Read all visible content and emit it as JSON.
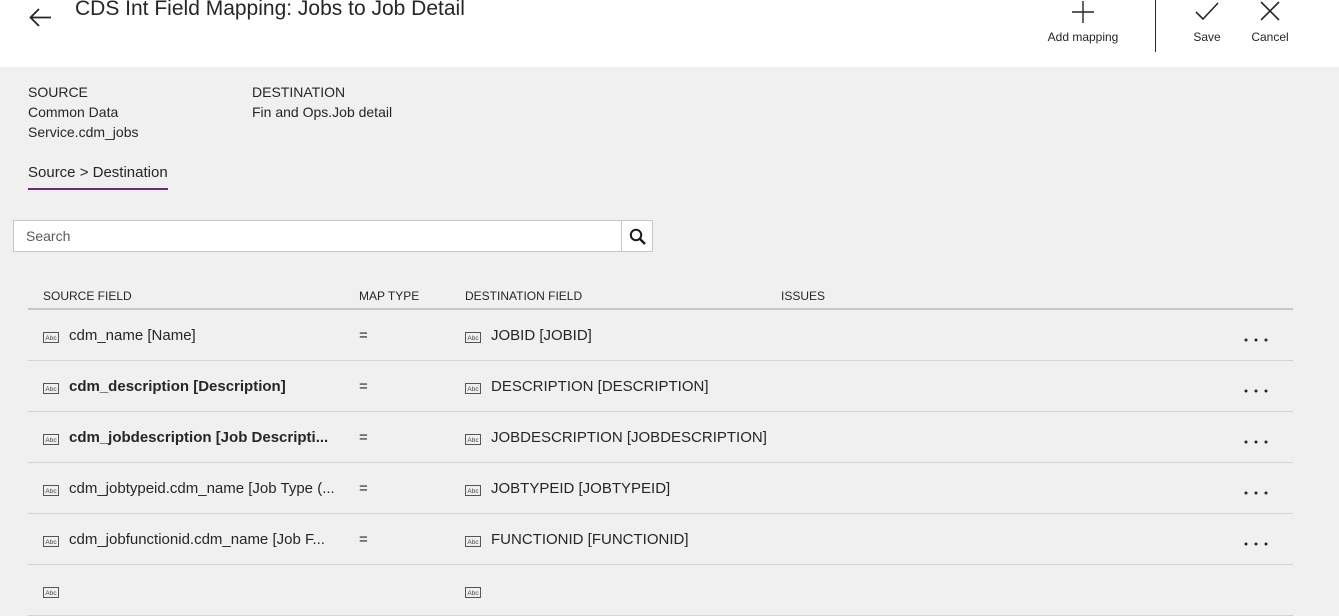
{
  "header": {
    "title": "CDS Int Field Mapping: Jobs to Job Detail",
    "back_icon": "arrow-left-icon",
    "commands": [
      {
        "label": "Add mapping",
        "icon": "plus-icon"
      },
      {
        "label": "Save",
        "icon": "checkmark-icon"
      },
      {
        "label": "Cancel",
        "icon": "close-icon"
      }
    ]
  },
  "source": {
    "heading": "SOURCE",
    "line1": "Common Data",
    "line2": "Service.cdm_jobs"
  },
  "destination": {
    "heading": "DESTINATION",
    "value": "Fin and Ops.Job detail"
  },
  "tab": {
    "label": "Source > Destination",
    "accent_color": "#6b2c72"
  },
  "search": {
    "placeholder": "Search",
    "value": "",
    "icon": "search-icon"
  },
  "grid": {
    "columns": [
      "SOURCE FIELD",
      "MAP TYPE",
      "DESTINATION FIELD",
      "ISSUES"
    ],
    "rows": [
      {
        "source": "cdm_name [Name]",
        "map_type": "=",
        "destination": "JOBID [JOBID]",
        "issues": "",
        "bold": false
      },
      {
        "source": "cdm_description [Description]",
        "map_type": "=",
        "destination": "DESCRIPTION [DESCRIPTION]",
        "issues": "",
        "bold": true
      },
      {
        "source": "cdm_jobdescription [Job Descripti...",
        "map_type": "=",
        "destination": "JOBDESCRIPTION [JOBDESCRIPTION]",
        "issues": "",
        "bold": true
      },
      {
        "source": "cdm_jobtypeid.cdm_name [Job Type (...",
        "map_type": "=",
        "destination": "JOBTYPEID [JOBTYPEID]",
        "issues": "",
        "bold": false
      },
      {
        "source": "cdm_jobfunctionid.cdm_name [Job F...",
        "map_type": "=",
        "destination": "FUNCTIONID [FUNCTIONID]",
        "issues": "",
        "bold": false
      }
    ],
    "more_label": "· · ·"
  }
}
